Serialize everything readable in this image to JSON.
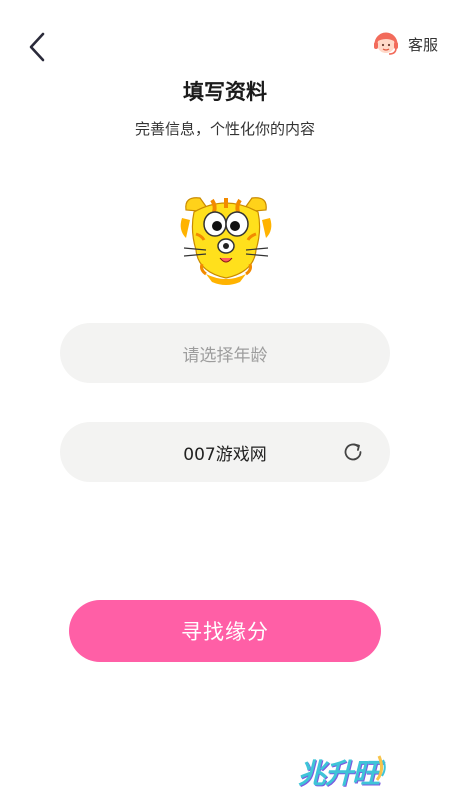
{
  "header": {
    "back_icon": "chevron-left-icon",
    "service_icon": "customer-service-icon",
    "service_label": "客服"
  },
  "page": {
    "title": "填写资料",
    "subtitle": "完善信息，个性化你的内容"
  },
  "avatar": {
    "icon": "cartoon-cat-avatar"
  },
  "form": {
    "age_placeholder": "请选择年龄",
    "nickname_value": "007游戏网",
    "refresh_icon": "refresh-icon"
  },
  "submit": {
    "label": "寻找缘分"
  },
  "watermark": {
    "text": "兆升旺"
  },
  "colors": {
    "accent": "#ff5fa6",
    "field_bg": "#f3f3f2",
    "placeholder": "#9d9d9d"
  }
}
